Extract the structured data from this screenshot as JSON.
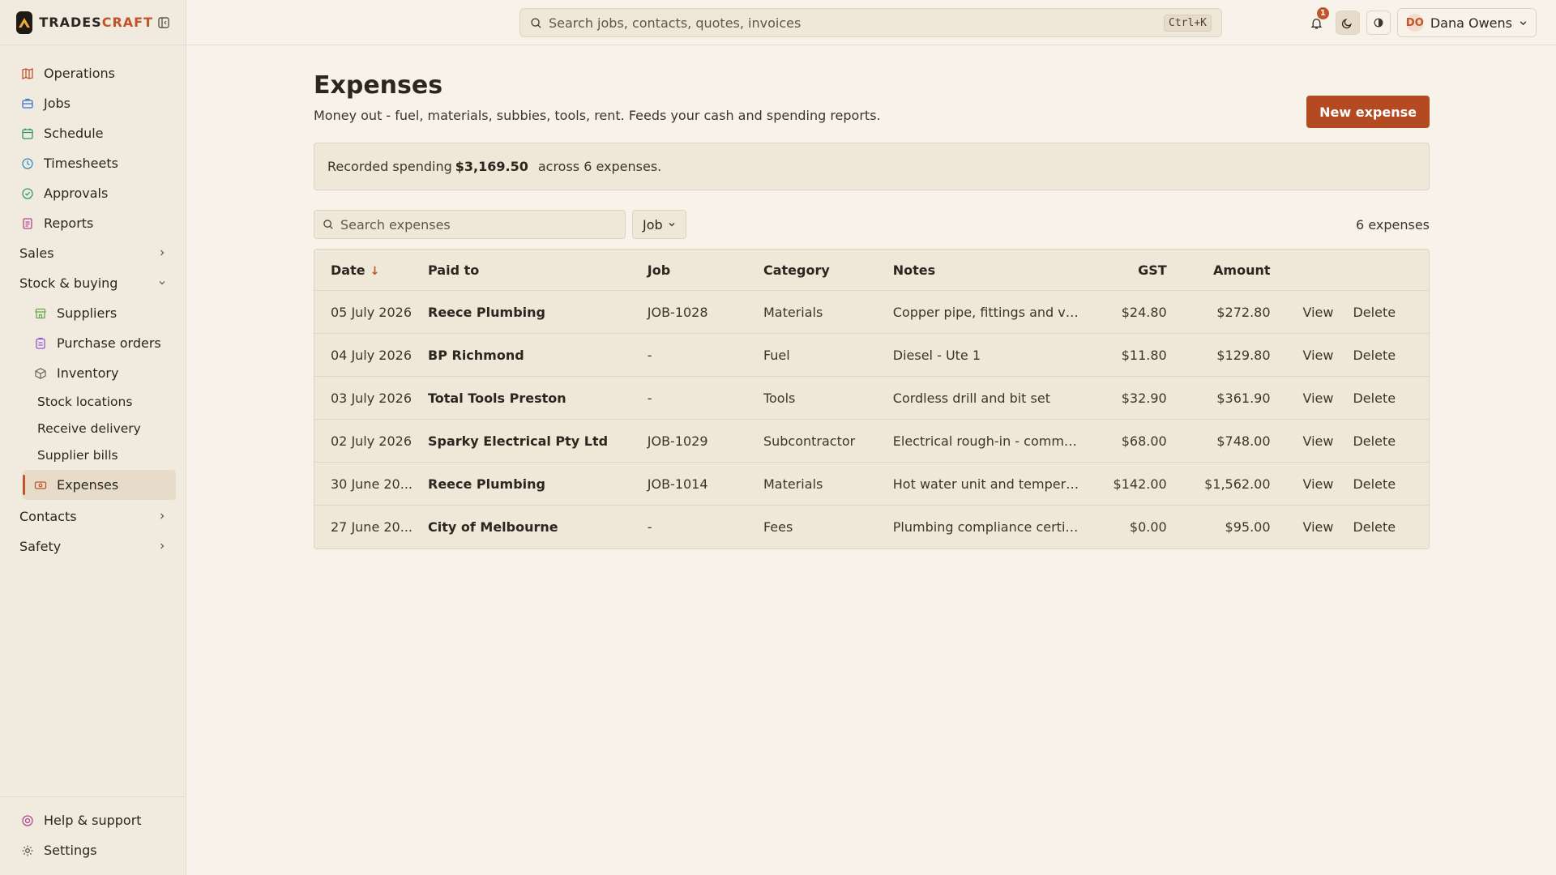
{
  "brand": {
    "trades": "TRADES",
    "craft": "CRAFT"
  },
  "search": {
    "placeholder": "Search jobs, contacts, quotes, invoices",
    "shortcut": "Ctrl+K"
  },
  "notifications": {
    "count": "1"
  },
  "user": {
    "initials": "DO",
    "name": "Dana Owens"
  },
  "sidebar": {
    "items": [
      {
        "label": "Operations",
        "icon": "map-icon"
      },
      {
        "label": "Jobs",
        "icon": "briefcase-icon"
      },
      {
        "label": "Schedule",
        "icon": "calendar-icon"
      },
      {
        "label": "Timesheets",
        "icon": "clock-icon"
      },
      {
        "label": "Approvals",
        "icon": "check-circle-icon"
      },
      {
        "label": "Reports",
        "icon": "report-icon"
      }
    ],
    "sales": "Sales",
    "stock": "Stock & buying",
    "stock_items": [
      {
        "label": "Suppliers"
      },
      {
        "label": "Purchase orders"
      },
      {
        "label": "Inventory"
      }
    ],
    "inventory_items": [
      {
        "label": "Stock locations"
      },
      {
        "label": "Receive delivery"
      },
      {
        "label": "Supplier bills"
      }
    ],
    "expenses": "Expenses",
    "contacts": "Contacts",
    "safety": "Safety",
    "help": "Help & support",
    "settings": "Settings"
  },
  "page": {
    "title": "Expenses",
    "subtitle": "Money out - fuel, materials, subbies, tools, rent. Feeds your cash and spending reports.",
    "new_button": "New expense"
  },
  "summary": {
    "prefix": "Recorded spending",
    "total": "$3,169.50",
    "suffix": "across 6 expenses."
  },
  "filters": {
    "search_placeholder": "Search expenses",
    "job_label": "Job",
    "count": "6 expenses"
  },
  "table": {
    "headers": {
      "date": "Date",
      "paid_to": "Paid to",
      "job": "Job",
      "category": "Category",
      "notes": "Notes",
      "gst": "GST",
      "amount": "Amount"
    },
    "rows": [
      {
        "date": "05 July 2026",
        "paid_to": "Reece Plumbing",
        "job": "JOB-1028",
        "category": "Materials",
        "notes": "Copper pipe, fittings and valves",
        "gst": "$24.80",
        "amount": "$272.80",
        "view": "View",
        "delete": "Delete"
      },
      {
        "date": "04 July 2026",
        "paid_to": "BP Richmond",
        "job": "-",
        "category": "Fuel",
        "notes": "Diesel - Ute 1",
        "gst": "$11.80",
        "amount": "$129.80",
        "view": "View",
        "delete": "Delete"
      },
      {
        "date": "03 July 2026",
        "paid_to": "Total Tools Preston",
        "job": "-",
        "category": "Tools",
        "notes": "Cordless drill and bit set",
        "gst": "$32.90",
        "amount": "$361.90",
        "view": "View",
        "delete": "Delete"
      },
      {
        "date": "02 July 2026",
        "paid_to": "Sparky Electrical Pty Ltd",
        "job": "JOB-1029",
        "category": "Subcontractor",
        "notes": "Electrical rough-in - commercial ...",
        "gst": "$68.00",
        "amount": "$748.00",
        "view": "View",
        "delete": "Delete"
      },
      {
        "date": "30 June 20...",
        "paid_to": "Reece Plumbing",
        "job": "JOB-1014",
        "category": "Materials",
        "notes": "Hot water unit and tempering va...",
        "gst": "$142.00",
        "amount": "$1,562.00",
        "view": "View",
        "delete": "Delete"
      },
      {
        "date": "27 June 20...",
        "paid_to": "City of Melbourne",
        "job": "-",
        "category": "Fees",
        "notes": "Plumbing compliance certificate",
        "gst": "$0.00",
        "amount": "$95.00",
        "view": "View",
        "delete": "Delete"
      }
    ]
  },
  "colors": {
    "accent": "#c2532a",
    "button": "#b44a22",
    "background": "#f7f3ea",
    "sidebar": "#f1ebdf"
  }
}
